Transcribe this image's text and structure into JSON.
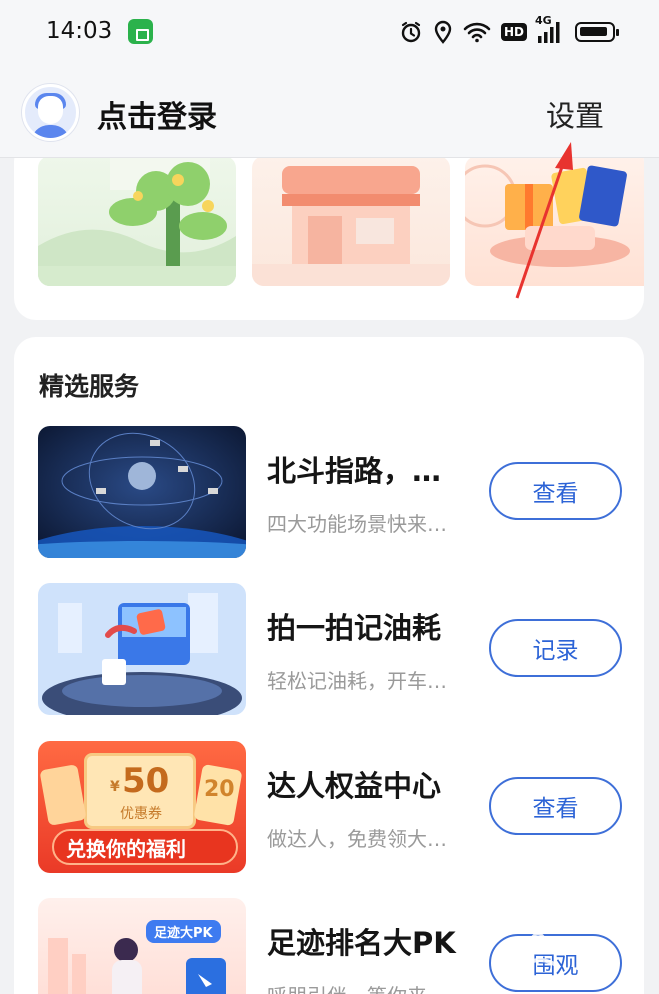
{
  "status_bar": {
    "time": "14:03",
    "hd_label": "HD",
    "network_label": "4G",
    "icons": [
      "app-icon",
      "alarm-icon",
      "location-icon",
      "wifi-icon",
      "hd-icon",
      "signal-icon",
      "battery-icon"
    ]
  },
  "header": {
    "login_label": "点击登录",
    "settings_label": "设置"
  },
  "services": {
    "section_title": "精选服务",
    "items": [
      {
        "title": "北斗指路，…",
        "desc": "四大功能场景快来…",
        "button": "查看"
      },
      {
        "title": "拍一拍记油耗",
        "desc": "轻松记油耗，开车…",
        "button": "记录"
      },
      {
        "title": "达人权益中心",
        "desc": "做达人，免费领大…",
        "button": "查看"
      },
      {
        "title": "足迹排名大PK",
        "desc": "呼朋引伴，等你来…",
        "button": "围观"
      }
    ],
    "thumb_texts": {
      "coupon_value": "50",
      "coupon_currency": "¥",
      "coupon_label": "优惠券",
      "coupon_banner": "兑换你的福利",
      "coupon_side": "20",
      "pk_badge": "足迹大PK"
    }
  },
  "colors": {
    "accent": "#2c63d6",
    "annotation": "#e8332f"
  }
}
